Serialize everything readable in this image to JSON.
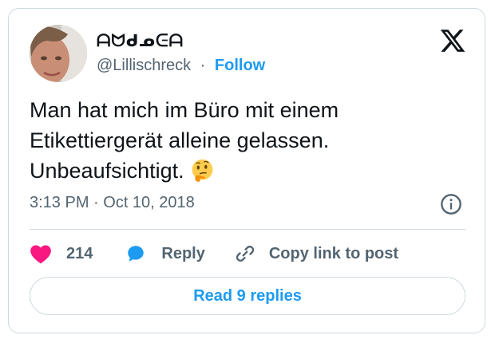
{
  "author": {
    "display_name": "ᗩᗢᑯᓄᕮᗩ",
    "handle": "@Lillischreck",
    "separator": "·",
    "follow_label": "Follow"
  },
  "tweet": {
    "line1": "Man hat mich im Büro mit einem",
    "line2": "Etikettiergerät alleine gelassen.",
    "line3": "Unbeaufsichtigt.",
    "emoji": "thinking-face"
  },
  "meta": {
    "timestamp": "3:13 PM · Oct 10, 2018"
  },
  "actions": {
    "like_count": "214",
    "reply_label": "Reply",
    "copy_label": "Copy link to post"
  },
  "read_replies_label": "Read 9 replies",
  "colors": {
    "accent": "#1d9bf0",
    "like": "#f91880",
    "text": "#0f1419",
    "muted": "#536471",
    "border": "#cfd9de"
  }
}
